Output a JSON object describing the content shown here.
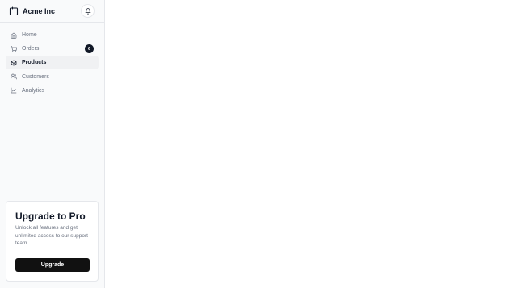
{
  "brand": {
    "name": "Acme Inc",
    "icon": "package-box-icon"
  },
  "header": {
    "notifications_icon": "bell-icon"
  },
  "nav": {
    "items": [
      {
        "label": "Home",
        "icon": "home-icon",
        "active": false
      },
      {
        "label": "Orders",
        "icon": "cart-icon",
        "active": false,
        "badge": "6"
      },
      {
        "label": "Products",
        "icon": "package-icon",
        "active": true
      },
      {
        "label": "Customers",
        "icon": "users-icon",
        "active": false
      },
      {
        "label": "Analytics",
        "icon": "line-chart-icon",
        "active": false
      }
    ]
  },
  "upgrade": {
    "title": "Upgrade to Pro",
    "description": "Unlock all features and get unlimited access to our support team",
    "button_label": "Upgrade"
  },
  "colors": {
    "sidebar_bg": "#f9fafb",
    "active_bg": "#f0f1f3",
    "primary": "#111111",
    "muted_text": "#6b7280",
    "border": "#e5e7eb"
  }
}
